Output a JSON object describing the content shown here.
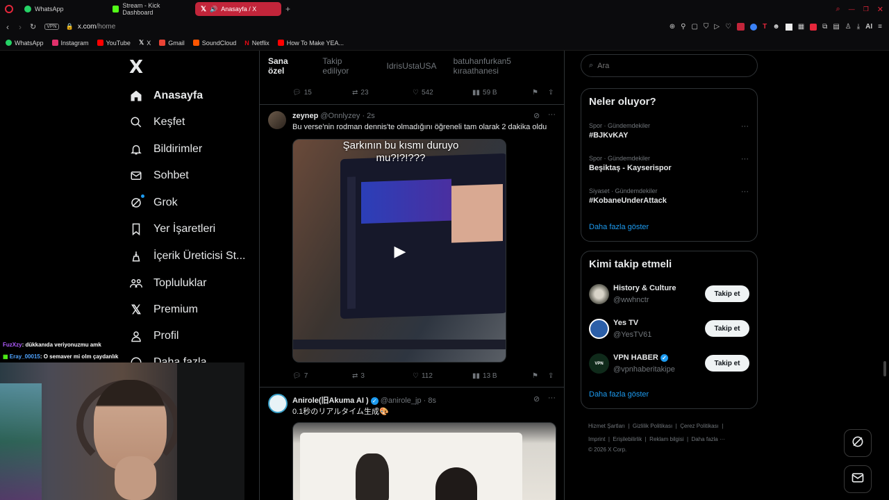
{
  "browser": {
    "tabs": [
      {
        "label": "WhatsApp",
        "color": "#25d366",
        "active": false
      },
      {
        "label": "Stream - Kick Dashboard",
        "color": "#53fc18",
        "active": false
      },
      {
        "label": "Anasayfa / X",
        "color": "#000000",
        "active": true
      }
    ],
    "new_tab": "+",
    "vpn": "VPN",
    "url_host": "x.com",
    "url_path": "/home",
    "ai_label": "AI",
    "bookmarks": [
      {
        "label": "WhatsApp",
        "color": "#25d366"
      },
      {
        "label": "Instagram",
        "color": "#e1306c"
      },
      {
        "label": "YouTube",
        "color": "#ff0000"
      },
      {
        "label": "X",
        "color": "#ffffff"
      },
      {
        "label": "Gmail",
        "color": "#ea4335"
      },
      {
        "label": "SoundCloud",
        "color": "#ff5500"
      },
      {
        "label": "Netflix",
        "color": "#e50914"
      },
      {
        "label": "How To Make YEA...",
        "color": "#ff0000"
      }
    ]
  },
  "nav": {
    "logo": "X",
    "items": [
      {
        "label": "Anasayfa",
        "icon": "home-icon"
      },
      {
        "label": "Keşfet",
        "icon": "search-icon"
      },
      {
        "label": "Bildirimler",
        "icon": "bell-icon"
      },
      {
        "label": "Sohbet",
        "icon": "mail-icon"
      },
      {
        "label": "Grok",
        "icon": "grok-icon"
      },
      {
        "label": "Yer İşaretleri",
        "icon": "bookmark-icon"
      },
      {
        "label": "İçerik Üreticisi St...",
        "icon": "creator-icon"
      },
      {
        "label": "Topluluklar",
        "icon": "communities-icon"
      },
      {
        "label": "Premium",
        "icon": "x-premium-icon"
      },
      {
        "label": "Profil",
        "icon": "profile-icon"
      },
      {
        "label": "Daha fazla",
        "icon": "more-icon"
      }
    ]
  },
  "feed": {
    "tabs": [
      "Sana özel",
      "Takip ediliyor",
      "IdrisUstaUSA",
      "batuhanfurkan5 kıraathanesi"
    ],
    "prev_actions": {
      "replies": "15",
      "reposts": "23",
      "likes": "542",
      "views": "59 B"
    },
    "tweet1": {
      "name": "zeynep",
      "handle": "@Onnlyzey",
      "time": "· 2s",
      "text": "Bu verse'nin rodman dennis'te olmadığını öğreneli tam olarak 2 dakika oldu",
      "video_caption": "Şarkının bu kısmı duruyo mu?!?!???",
      "replies": "7",
      "reposts": "3",
      "likes": "112",
      "views": "13 B"
    },
    "tweet2": {
      "name": "Anirole(旧Akuma AI )",
      "handle": "@anirole_jp",
      "time": "· 8s",
      "text": "0.1秒のリアルタイム生成🎨"
    }
  },
  "sidebar": {
    "search_placeholder": "Ara",
    "trends_title": "Neler oluyor?",
    "trends": [
      {
        "category": "Spor · Gündemdekiler",
        "name": "#BJKvKAY"
      },
      {
        "category": "Spor · Gündemdekiler",
        "name": "Beşiktaş - Kayserispor"
      },
      {
        "category": "Siyaset · Gündemdekiler",
        "name": "#KobaneUnderAttack"
      }
    ],
    "show_more": "Daha fazla göster",
    "follow_title": "Kimi takip etmeli",
    "follow": [
      {
        "name": "History & Culture",
        "handle": "@wwhnctr",
        "verified": false,
        "button": "Takip et"
      },
      {
        "name": "Yes TV",
        "handle": "@YesTV61",
        "verified": false,
        "button": "Takip et"
      },
      {
        "name": "VPN HABER",
        "handle": "@vpnhaberitakipe",
        "verified": true,
        "button": "Takip et"
      }
    ],
    "follow_more": "Daha fazla göster",
    "footer": [
      "Hizmet Şartları",
      "Gizlilik Politikası",
      "Çerez Politikası",
      "Imprint",
      "Erişilebilirlik",
      "Reklam bilgisi",
      "Daha fazla ···",
      "© 2026 X Corp."
    ]
  },
  "stream_chat": [
    {
      "user": "FuzXzy",
      "user_color": "#b05cff",
      "message": ": dükkanıda veriyonuzmu amk"
    },
    {
      "user": "Eray_00015",
      "user_color": "#4fa3ff",
      "message": ": O semaver mi olm çaydanlık"
    }
  ],
  "colors": {
    "accent": "#1d9bf0",
    "active_tab": "#c2253a",
    "border": "#2f3336"
  }
}
